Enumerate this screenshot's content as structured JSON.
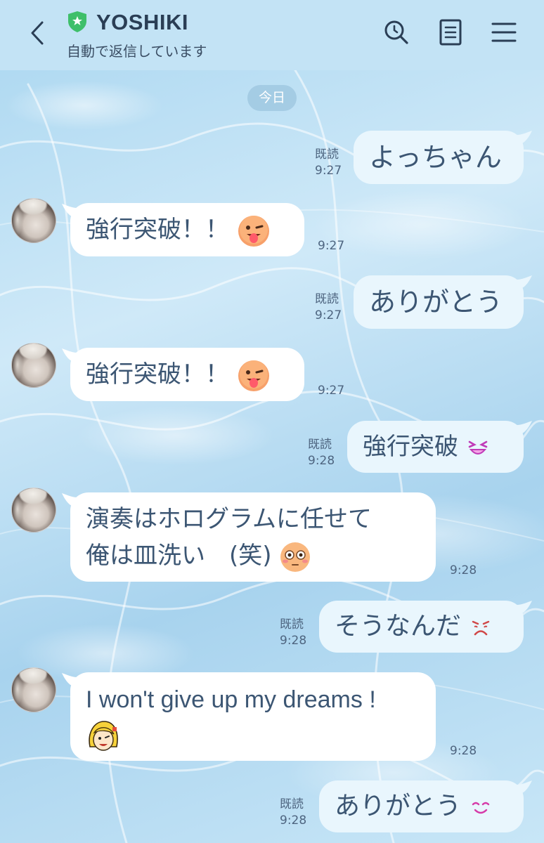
{
  "header": {
    "title": "YOSHIKI",
    "subtitle": "自動で返信しています"
  },
  "date_label": "今日",
  "messages": [
    {
      "dir": "out",
      "text": "よっちゃん",
      "read": "既読",
      "time": "9:27"
    },
    {
      "dir": "in",
      "text": "強行突破！！",
      "emoji": "winking-tongue-emoji",
      "time": "9:27"
    },
    {
      "dir": "out",
      "text": "ありがとう",
      "read": "既読",
      "time": "9:27"
    },
    {
      "dir": "in",
      "text": "強行突破！！",
      "emoji": "winking-tongue-emoji",
      "time": "9:27"
    },
    {
      "dir": "out",
      "text": "強行突破",
      "emoji": "squinting-grin-emoji",
      "read": "既読",
      "time": "9:28"
    },
    {
      "dir": "in",
      "line1": "演奏はホログラムに任せて",
      "line2": "俺は皿洗い　(笑)",
      "emoji": "flushed-emoji",
      "time": "9:28"
    },
    {
      "dir": "out",
      "text": "そうなんだ",
      "emoji": "sad-face-emoji",
      "read": "既読",
      "time": "9:28"
    },
    {
      "dir": "in",
      "text": "I won't give up my dreams !",
      "emoji": "blonde-character-sticker",
      "time": "9:28"
    },
    {
      "dir": "out",
      "text": "ありがとう",
      "emoji": "smiling-face-emoji",
      "read": "既読",
      "time": "9:28"
    }
  ],
  "colors": {
    "header_bg": "#c3e3f5",
    "title": "#2a3e55",
    "bubble_text": "#3c5673",
    "shield_green": "#3ebf6a"
  }
}
